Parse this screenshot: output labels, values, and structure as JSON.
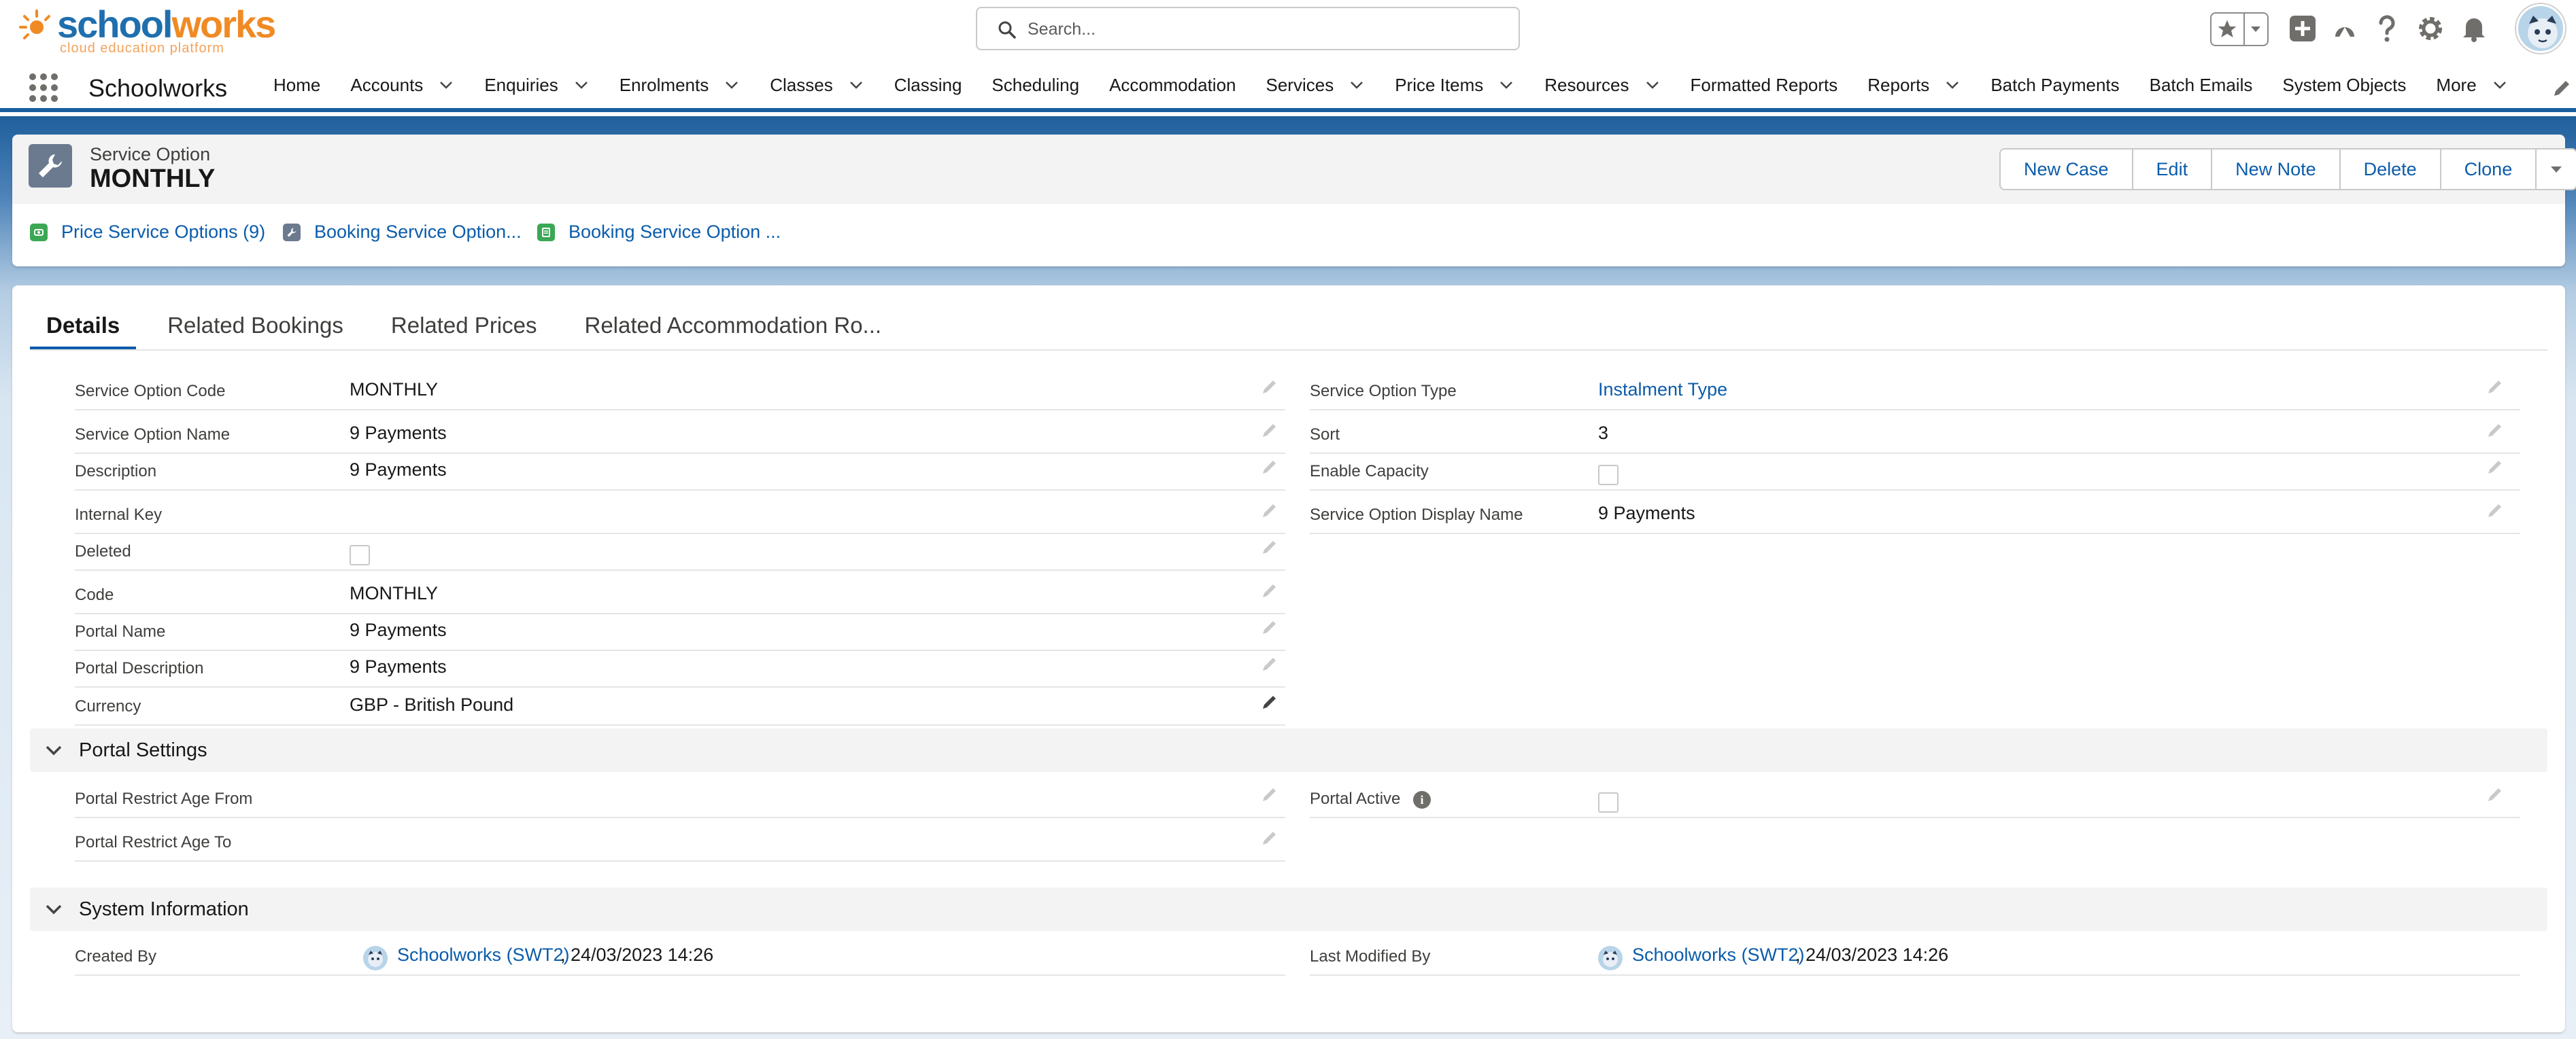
{
  "brand": {
    "logo_word_part1": "school",
    "logo_word_part2": "works",
    "logo_tagline": "cloud education platform",
    "accent_color": "#0b5cab",
    "nav_border_color": "#1b5f9e"
  },
  "header": {
    "search_placeholder": "Search...",
    "icons": [
      "star-icon",
      "chevron-down-icon",
      "add-icon",
      "trailhead-icon",
      "help-icon",
      "gear-icon",
      "bell-icon",
      "avatar"
    ]
  },
  "nav": {
    "app_name": "Schoolworks",
    "items": [
      {
        "label": "Home",
        "dropdown": false
      },
      {
        "label": "Accounts",
        "dropdown": true
      },
      {
        "label": "Enquiries",
        "dropdown": true
      },
      {
        "label": "Enrolments",
        "dropdown": true
      },
      {
        "label": "Classes",
        "dropdown": true
      },
      {
        "label": "Classing",
        "dropdown": false
      },
      {
        "label": "Scheduling",
        "dropdown": false
      },
      {
        "label": "Accommodation",
        "dropdown": false
      },
      {
        "label": "Services",
        "dropdown": true
      },
      {
        "label": "Price Items",
        "dropdown": true
      },
      {
        "label": "Resources",
        "dropdown": true
      },
      {
        "label": "Formatted Reports",
        "dropdown": false
      },
      {
        "label": "Reports",
        "dropdown": true
      },
      {
        "label": "Batch Payments",
        "dropdown": false
      },
      {
        "label": "Batch Emails",
        "dropdown": false
      },
      {
        "label": "System Objects",
        "dropdown": false
      },
      {
        "label": "More",
        "dropdown": true
      }
    ]
  },
  "record": {
    "object_type": "Service Option",
    "title": "MONTHLY",
    "icon": "wrench-icon",
    "actions": [
      "New Case",
      "Edit",
      "New Note",
      "Delete",
      "Clone"
    ],
    "highlights": [
      {
        "label": "Price Service Options (9)",
        "icon": "price-icon",
        "color": "#3ba755"
      },
      {
        "label": "Booking Service Option...",
        "icon": "wrench-icon",
        "color": "#6b7a8f"
      },
      {
        "label": "Booking Service Option ...",
        "icon": "booking-icon",
        "color": "#3ba755"
      }
    ]
  },
  "tabs": [
    "Details",
    "Related Bookings",
    "Related Prices",
    "Related Accommodation Ro..."
  ],
  "details": {
    "left": [
      {
        "label": "Service Option Code",
        "value": "MONTHLY"
      },
      {
        "label": "Service Option Name",
        "value": "9 Payments"
      },
      {
        "label": "Description",
        "value": "9 Payments"
      },
      {
        "label": "Internal Key",
        "value": ""
      },
      {
        "label": "Deleted",
        "value": "",
        "checkbox": true,
        "checked": false
      },
      {
        "label": "Code",
        "value": "MONTHLY"
      },
      {
        "label": "Portal Name",
        "value": "9 Payments"
      },
      {
        "label": "Portal Description",
        "value": "9 Payments"
      },
      {
        "label": "Currency",
        "value": "GBP - British Pound"
      }
    ],
    "right": [
      {
        "label": "Service Option Type",
        "value": "Instalment Type",
        "link": true
      },
      {
        "label": "Sort",
        "value": "3"
      },
      {
        "label": "Enable Capacity",
        "value": "",
        "checkbox": true,
        "checked": false
      },
      {
        "label": "Service Option Display Name",
        "value": "9 Payments"
      }
    ]
  },
  "portal_settings": {
    "title": "Portal Settings",
    "left": [
      {
        "label": "Portal Restrict Age From",
        "value": ""
      },
      {
        "label": "Portal Restrict Age To",
        "value": ""
      }
    ],
    "right": [
      {
        "label": "Portal Active",
        "value": "",
        "checkbox": true,
        "checked": false,
        "info": true
      }
    ]
  },
  "system_info": {
    "title": "System Information",
    "created_by_label": "Created By",
    "created_by_user": "Schoolworks (SWT2)",
    "created_by_date": ", 24/03/2023 14:26",
    "modified_by_label": "Last Modified By",
    "modified_by_user": "Schoolworks (SWT2)",
    "modified_by_date": ", 24/03/2023 14:26"
  }
}
